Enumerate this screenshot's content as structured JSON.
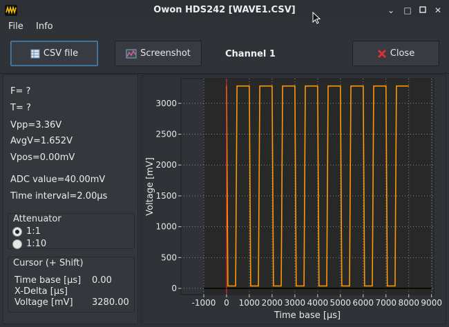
{
  "window": {
    "title": "Owon HDS242 [WAVE1.CSV]",
    "minimize_glyph": "⌄",
    "maximize_glyph": "□",
    "close_glyph": "✕"
  },
  "menu": {
    "file": "File",
    "info": "Info"
  },
  "toolbar": {
    "csv_button": "CSV file",
    "screenshot_button": "Screenshot",
    "channel_label": "Channel 1",
    "close_button": "Close"
  },
  "readouts": {
    "frequency": "F=  ?",
    "period": "T=  ?",
    "vpp": "Vpp=3.36V",
    "avgv": "AvgV=1.652V",
    "vpos": "Vpos=0.00mV",
    "adc": "ADC value=40.00mV",
    "time_interval": "Time interval=2.00µs"
  },
  "attenuator": {
    "title": "Attenuator",
    "options": [
      {
        "label": "1:1",
        "checked": true
      },
      {
        "label": "1:10",
        "checked": false
      }
    ]
  },
  "cursor": {
    "title": "Cursor (+ Shift)",
    "time_base_label": "Time base [µs]",
    "time_base_value": "0.00",
    "xdelta_label": "X-Delta [µs]",
    "xdelta_value": "",
    "voltage_label": "Voltage [mV]",
    "voltage_value": "3280.00"
  },
  "chart_data": {
    "type": "line",
    "xlabel": "Time base [µs]",
    "ylabel": "Voltage [mV]",
    "xlim": [
      -2000,
      9100
    ],
    "ylim": [
      -100,
      3400
    ],
    "xticks": [
      -1000,
      0,
      1000,
      2000,
      3000,
      4000,
      5000,
      6000,
      7000,
      8000,
      9000
    ],
    "yticks": [
      0,
      500,
      1000,
      1500,
      2000,
      2500,
      3000
    ],
    "grid": true,
    "cursor_x": 0,
    "data_range_x": [
      -1000,
      8000
    ],
    "series": [
      {
        "color": "#ff9900",
        "x": [
          0,
          60,
          400,
          460,
          1000,
          1060,
          1400,
          1460,
          2000,
          2060,
          2400,
          2460,
          3000,
          3060,
          3400,
          3460,
          4000,
          4060,
          4400,
          4460,
          5000,
          5060,
          5400,
          5460,
          6000,
          6060,
          6400,
          6460,
          7000,
          7060,
          7400,
          7460,
          8000
        ],
        "y": [
          3280,
          40,
          40,
          3280,
          3280,
          40,
          40,
          3280,
          3280,
          40,
          40,
          3280,
          3280,
          40,
          40,
          3280,
          3280,
          40,
          40,
          3280,
          3280,
          40,
          40,
          3280,
          3280,
          40,
          40,
          3280,
          3280,
          40,
          40,
          3280,
          3280
        ]
      }
    ],
    "colors": {
      "plot_bg": "#282828",
      "outer_bg": "#2f3237",
      "cursor": "#ff2a2a",
      "zero_line": "#000000",
      "grid": "#8a8a8a"
    }
  }
}
